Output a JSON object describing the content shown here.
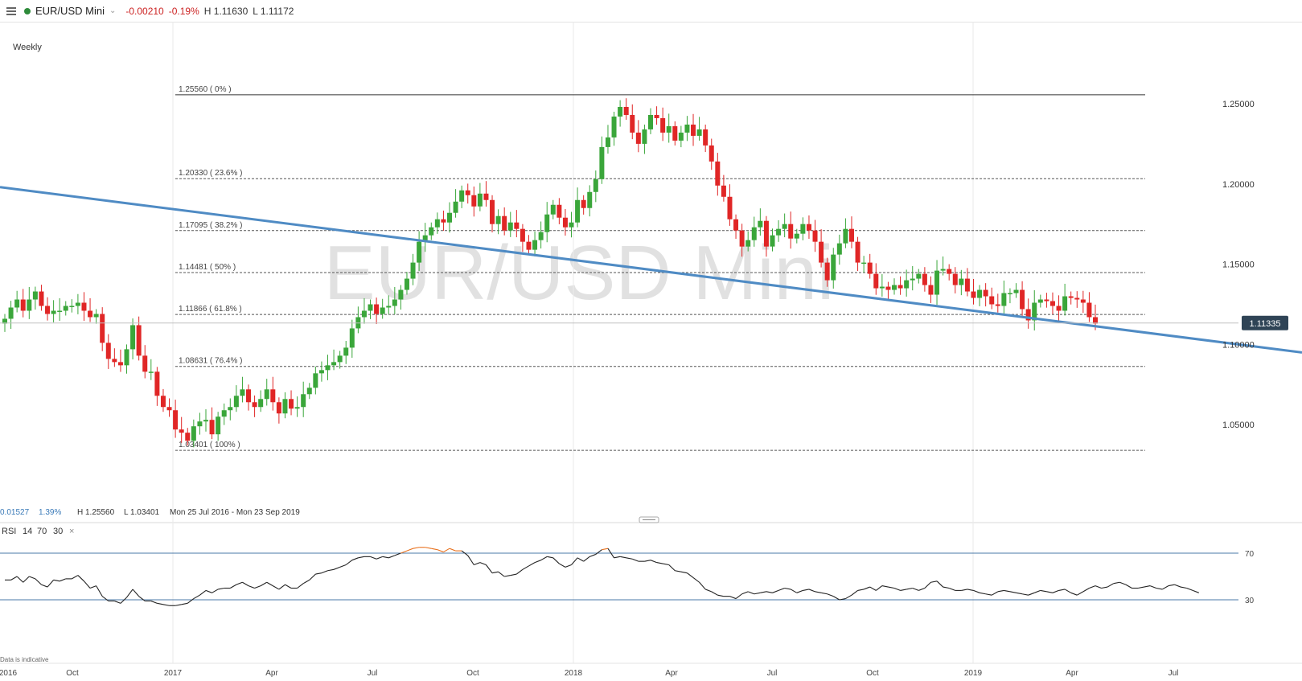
{
  "header": {
    "symbol": "EUR/USD Mini",
    "change": "-0.00210",
    "change_pct": "-0.19%",
    "high": "H 1.11630",
    "low": "L 1.11172",
    "status_color": "#2e8b3a",
    "interval": "Weekly"
  },
  "watermark": "EUR/USD Mini",
  "info": {
    "change": "0.01527",
    "change_pct": "1.39%",
    "high": "H 1.25560",
    "low": "L 1.03401",
    "range": "Mon 25 Jul 2016 - Mon 23 Sep 2019"
  },
  "rsi_panel": {
    "name": "RSI",
    "period": "14",
    "overbought": "70",
    "oversold": "30",
    "close": "×"
  },
  "disclaimer": "Data is indicative",
  "colors": {
    "up": "#3aa63a",
    "down": "#e02626",
    "trendline": "#4f8bc4",
    "rsi": "#222222",
    "rsi_extreme": "#e8701c",
    "last_price_bg": "#2f4456"
  },
  "chart_data": [
    {
      "type": "candlestick",
      "yticks": [
        "1.25000",
        "1.20000",
        "1.15000",
        "1.10000",
        "1.05000"
      ],
      "ylim": [
        1.015,
        1.27
      ],
      "last_price": "1.11335",
      "x_ticks": [
        "2016",
        "Oct",
        "2017",
        "Apr",
        "Jul",
        "Oct",
        "2018",
        "Apr",
        "Jul",
        "Oct",
        "2019",
        "Apr",
        "Jul"
      ],
      "fibonacci": [
        {
          "label": "1.25560 ( 0% )",
          "value": 1.2556
        },
        {
          "label": "1.20330 ( 23.6% )",
          "value": 1.2033
        },
        {
          "label": "1.17095 ( 38.2% )",
          "value": 1.17095
        },
        {
          "label": "1.14481 ( 50% )",
          "value": 1.14481
        },
        {
          "label": "1.11866 ( 61.8% )",
          "value": 1.11866
        },
        {
          "label": "1.08631 ( 76.4% )",
          "value": 1.08631
        },
        {
          "label": "1.03401 ( 100% )",
          "value": 1.03401
        }
      ],
      "trendline": {
        "start": 1.198,
        "end": 1.095
      },
      "closes": [
        1.116,
        1.123,
        1.128,
        1.121,
        1.128,
        1.133,
        1.124,
        1.119,
        1.121,
        1.121,
        1.124,
        1.124,
        1.126,
        1.121,
        1.117,
        1.119,
        1.101,
        1.091,
        1.089,
        1.087,
        1.097,
        1.112,
        1.093,
        1.083,
        1.083,
        1.068,
        1.061,
        1.059,
        1.047,
        1.045,
        1.04,
        1.049,
        1.052,
        1.053,
        1.044,
        1.055,
        1.059,
        1.061,
        1.068,
        1.072,
        1.064,
        1.061,
        1.066,
        1.072,
        1.064,
        1.057,
        1.066,
        1.06,
        1.061,
        1.069,
        1.073,
        1.082,
        1.084,
        1.087,
        1.089,
        1.093,
        1.098,
        1.11,
        1.117,
        1.121,
        1.125,
        1.119,
        1.123,
        1.124,
        1.128,
        1.134,
        1.141,
        1.151,
        1.164,
        1.168,
        1.173,
        1.178,
        1.176,
        1.182,
        1.189,
        1.196,
        1.193,
        1.186,
        1.194,
        1.19,
        1.175,
        1.18,
        1.171,
        1.176,
        1.172,
        1.164,
        1.159,
        1.165,
        1.17,
        1.181,
        1.187,
        1.179,
        1.173,
        1.176,
        1.19,
        1.185,
        1.195,
        1.203,
        1.223,
        1.229,
        1.242,
        1.248,
        1.243,
        1.232,
        1.225,
        1.234,
        1.243,
        1.241,
        1.232,
        1.236,
        1.227,
        1.232,
        1.237,
        1.23,
        1.234,
        1.224,
        1.214,
        1.199,
        1.192,
        1.178,
        1.171,
        1.161,
        1.165,
        1.173,
        1.177,
        1.161,
        1.168,
        1.172,
        1.175,
        1.166,
        1.169,
        1.175,
        1.171,
        1.164,
        1.151,
        1.14,
        1.156,
        1.163,
        1.172,
        1.164,
        1.151,
        1.151,
        1.144,
        1.135,
        1.136,
        1.134,
        1.137,
        1.135,
        1.14,
        1.141,
        1.144,
        1.137,
        1.131,
        1.146,
        1.147,
        1.144,
        1.137,
        1.141,
        1.133,
        1.129,
        1.134,
        1.13,
        1.125,
        1.124,
        1.132,
        1.132,
        1.134,
        1.122,
        1.115,
        1.126,
        1.128,
        1.127,
        1.124,
        1.121,
        1.13,
        1.129,
        1.128,
        1.126,
        1.117,
        1.113
      ]
    },
    {
      "type": "line",
      "name": "RSI 14",
      "ylim": [
        0,
        100
      ],
      "levels": [
        70,
        30
      ],
      "values": [
        47,
        47,
        50,
        45,
        50,
        48,
        43,
        41,
        47,
        46,
        48,
        48,
        51,
        46,
        40,
        42,
        33,
        29,
        29,
        27,
        32,
        39,
        33,
        29,
        29,
        27,
        26,
        25,
        25,
        26,
        27,
        31,
        34,
        38,
        36,
        39,
        40,
        40,
        43,
        45,
        42,
        40,
        42,
        45,
        42,
        39,
        43,
        40,
        40,
        44,
        47,
        52,
        53,
        55,
        56,
        58,
        60,
        64,
        66,
        67,
        67,
        65,
        67,
        66,
        68,
        70,
        72,
        74,
        75,
        75,
        74,
        73,
        71,
        74,
        72,
        72,
        68,
        60,
        62,
        60,
        53,
        54,
        50,
        51,
        52,
        56,
        59,
        62,
        64,
        67,
        66,
        61,
        58,
        60,
        66,
        63,
        67,
        69,
        73,
        74,
        66,
        67,
        66,
        65,
        63,
        63,
        64,
        62,
        61,
        60,
        55,
        54,
        53,
        49,
        45,
        39,
        37,
        34,
        33,
        33,
        31,
        35,
        37,
        35,
        36,
        37,
        36,
        38,
        40,
        39,
        36,
        38,
        39,
        37,
        36,
        35,
        33,
        30,
        31,
        34,
        38,
        39,
        41,
        38,
        42,
        41,
        40,
        38,
        39,
        40,
        38,
        40,
        45,
        46,
        41,
        40,
        38,
        38,
        39,
        38,
        36,
        35,
        34,
        37,
        38,
        37,
        36,
        35,
        34,
        36,
        38,
        37,
        36,
        38,
        39,
        36,
        34,
        37,
        40,
        42,
        40,
        41,
        44,
        45,
        43,
        40,
        40,
        41,
        42,
        40,
        39,
        42,
        43,
        41,
        40,
        38,
        36
      ]
    }
  ]
}
